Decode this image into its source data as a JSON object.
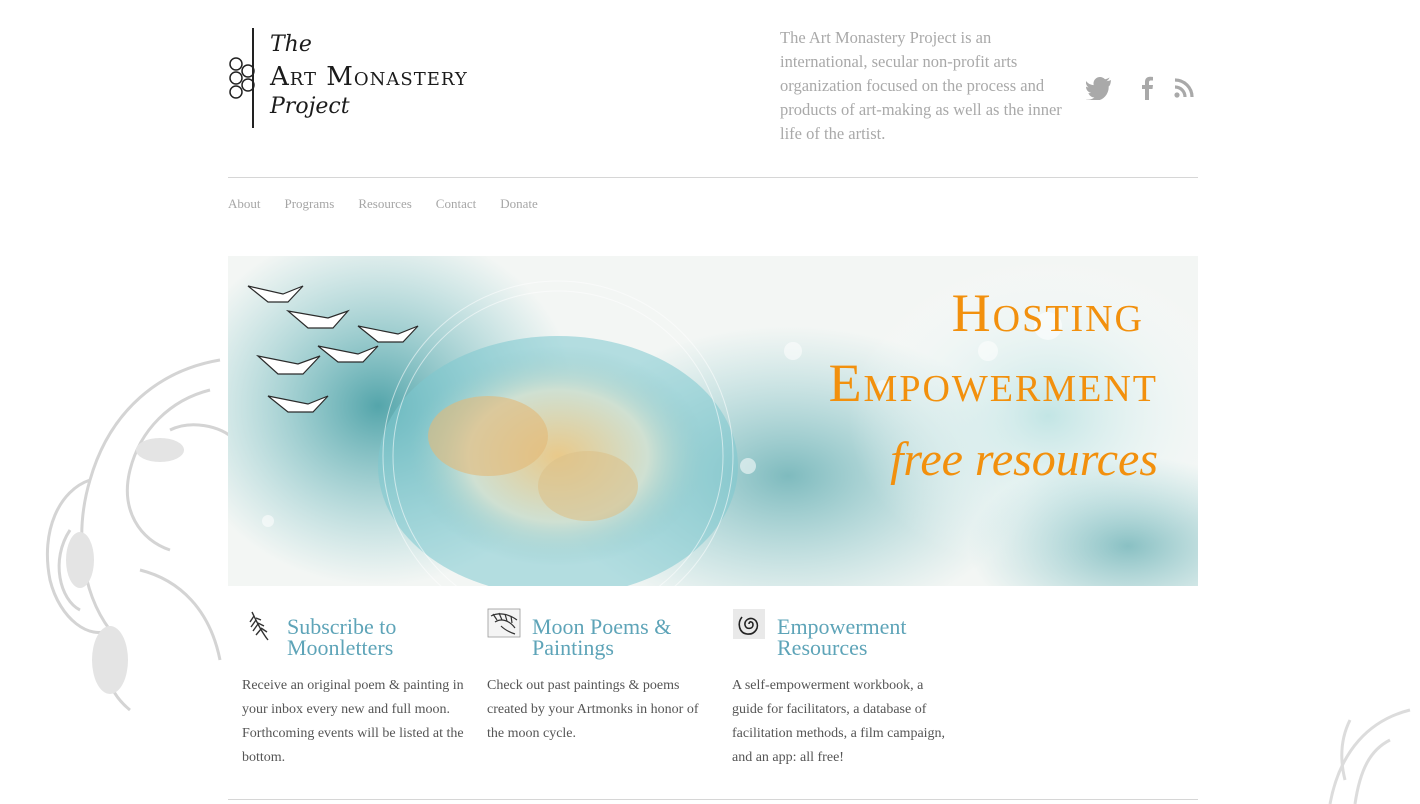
{
  "logo": {
    "line1": "The",
    "line2": "Art Monastery",
    "line3": "Project"
  },
  "header": {
    "tagline": "The Art Monastery Project is an international, secular non-profit arts organization focused on the process and products of art-making as well as the inner life of the artist.",
    "social": [
      "twitter-icon",
      "facebook-icon",
      "rss-icon"
    ]
  },
  "nav": {
    "items": [
      "About",
      "Programs",
      "Resources",
      "Contact",
      "Donate"
    ]
  },
  "hero": {
    "title_line1": "Hosting",
    "title_line2": "Empowerment",
    "subtitle": "free resources"
  },
  "cards": [
    {
      "icon": "feather-icon",
      "title": "Subscribe to Moonletters",
      "text": "Receive an original poem & painting in your inbox every new and full moon. Forthcoming events will be listed at the bottom."
    },
    {
      "icon": "leaf-sketch-icon",
      "title": "Moon Poems & Paintings",
      "text": "Check out past paintings & poems created by your Artmonks in honor of the moon cycle."
    },
    {
      "icon": "spiral-icon",
      "title": "Empowerment Resources",
      "text": "A self-empowerment workbook, a guide for facilitators, a database of facilitation methods, a film campaign, and an app: all free!"
    }
  ],
  "colors": {
    "accent_orange": "#f2900d",
    "card_title_teal": "#5ea4b8",
    "muted_text": "#a9a9a9"
  }
}
